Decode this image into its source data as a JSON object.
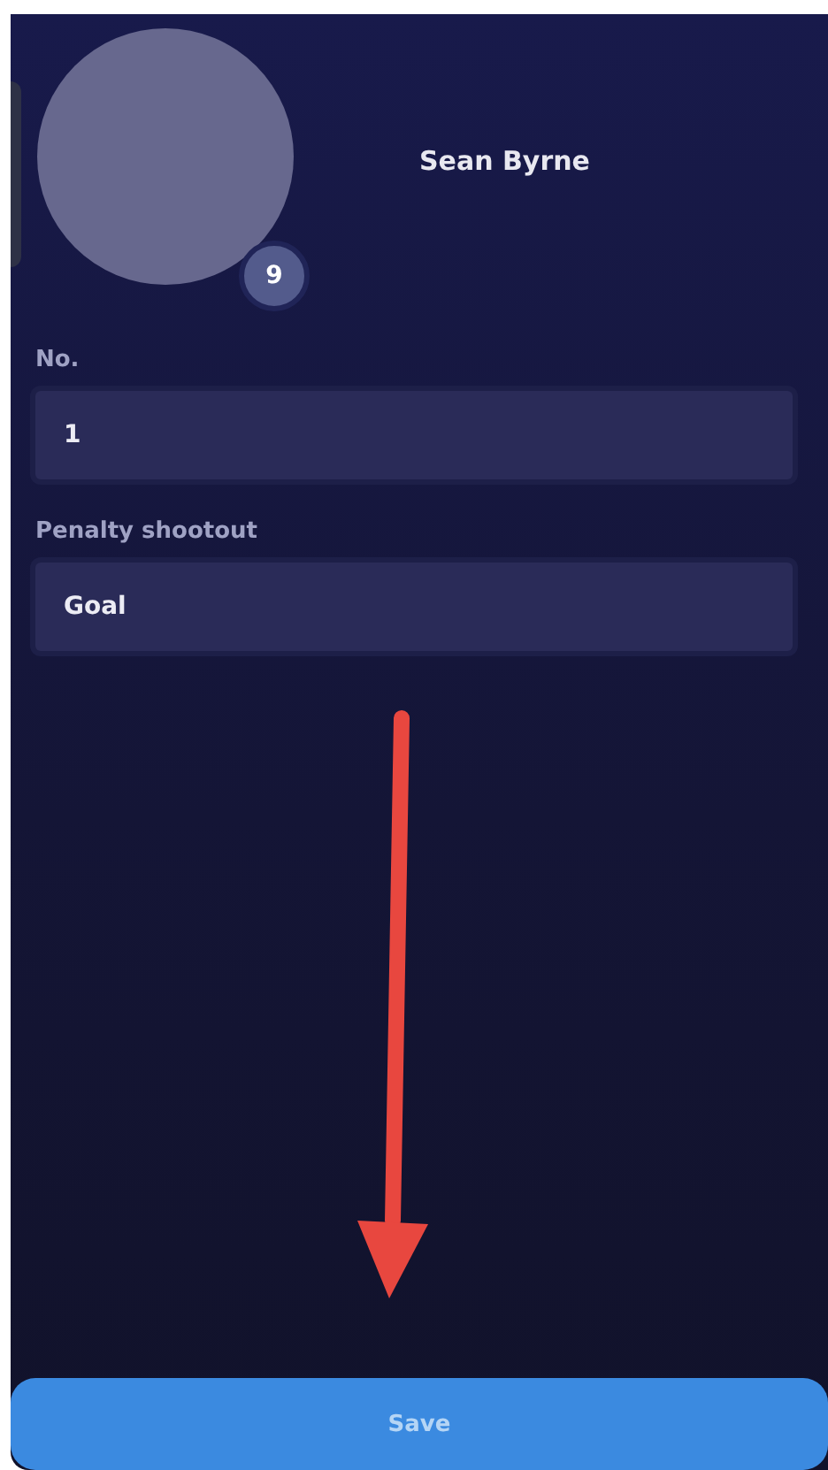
{
  "player": {
    "name": "Sean Byrne",
    "badge": "9"
  },
  "fields": [
    {
      "label": "No.",
      "value": "1"
    },
    {
      "label": "Penalty shootout",
      "value": "Goal"
    }
  ],
  "annotation": {
    "kind": "arrow"
  },
  "save_button": {
    "label": "Save"
  }
}
